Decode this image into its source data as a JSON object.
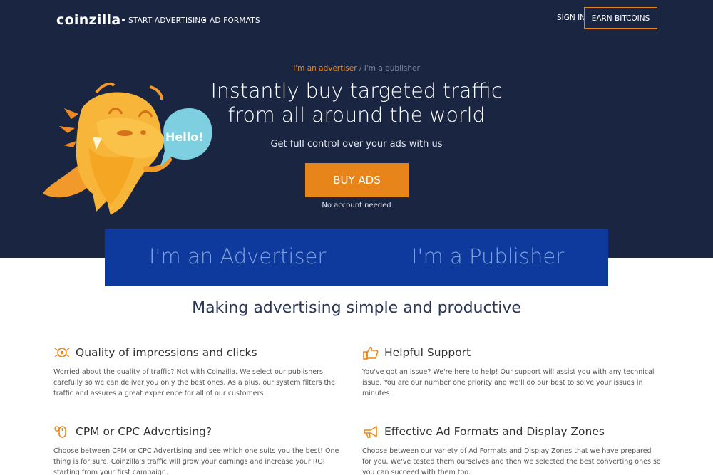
{
  "header": {
    "logo": "coinzilla",
    "nav": [
      {
        "label": "START ADVERTISING"
      },
      {
        "label": "AD FORMATS"
      }
    ],
    "signin": "SIGN IN",
    "earn": "EARN BITCOINS"
  },
  "hero": {
    "switch_advertiser": "I'm an advertiser",
    "switch_separator": " / ",
    "switch_publisher": "I'm a publisher",
    "headline_line1": "Instantly buy targeted traffic",
    "headline_line2": "from all around the world",
    "subhead": "Get full control over your ads with us",
    "cta": "BUY ADS",
    "note": "No account needed",
    "bubble": "Hello!"
  },
  "band": {
    "advertiser": "I'm an Advertiser",
    "publisher": "I'm a Publisher"
  },
  "section": {
    "title": "Making advertising simple and productive"
  },
  "features": [
    {
      "title": "Quality of impressions and clicks",
      "text": "Worried about the quality of traffic? Not with Coinzilla. We select our publishers carefully so we can deliver you only the best ones. As a plus, our system filters the traffic and assures a great experience for all of our customers.",
      "icon": "target-icon"
    },
    {
      "title": "Helpful Support",
      "text": "You've got an issue? We're here to help! Our support will assist you with any technical issue. You are our number one priority and we'll do our best to solve your issues in minutes.",
      "icon": "thumbs-up-icon"
    },
    {
      "title": "CPM or CPC Advertising?",
      "text": "Choose between CPM or CPC Advertising and see which one suits you the best! One thing is for sure, Coinzilla's traffic will grow your earnings and increase your ROI starting from your first campaign.",
      "icon": "mouse-icon"
    },
    {
      "title": "Effective Ad Formats and Display Zones",
      "text": "Choose between our variety of Ad Formats and Display Zones that we have prepared for you. We've tested them ourselves and then we selected the best converting ones so you can succeed with them too.",
      "icon": "megaphone-icon"
    }
  ],
  "colors": {
    "navy": "#1a2542",
    "orange": "#e8851a",
    "blue_band": "#0d3a9c",
    "bubble": "#7ecfe0"
  }
}
